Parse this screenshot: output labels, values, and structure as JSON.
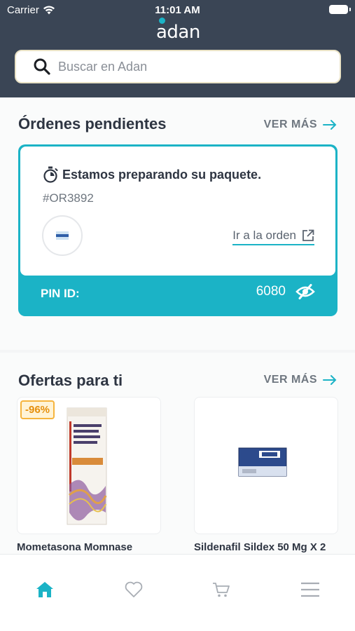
{
  "status_bar": {
    "carrier": "Carrier",
    "time": "11:01 AM"
  },
  "app": {
    "logo_text": "adan"
  },
  "search": {
    "placeholder": "Buscar en Adan"
  },
  "orders": {
    "title": "Órdenes pendientes",
    "see_more": "VER MÁS",
    "card": {
      "status": "Estamos preparando su paquete.",
      "order_id": "#OR3892",
      "link_label": "Ir a la orden",
      "pin_label": "PIN ID:",
      "pin_value": "6080"
    }
  },
  "offers": {
    "title": "Ofertas para ti",
    "see_more": "VER MÁS",
    "products": [
      {
        "name": "Mometasona Momnase",
        "discount": "-96%"
      },
      {
        "name": "Sildenafil Sildex 50 Mg X 2"
      }
    ]
  },
  "tabbar": {
    "items": [
      {
        "icon": "home-icon",
        "active": true
      },
      {
        "icon": "heart-icon",
        "active": false
      },
      {
        "icon": "cart-icon",
        "active": false
      },
      {
        "icon": "menu-icon",
        "active": false
      }
    ]
  },
  "colors": {
    "header": "#3a4555",
    "accent": "#1bb3c6",
    "discount": "#f6b43d"
  }
}
